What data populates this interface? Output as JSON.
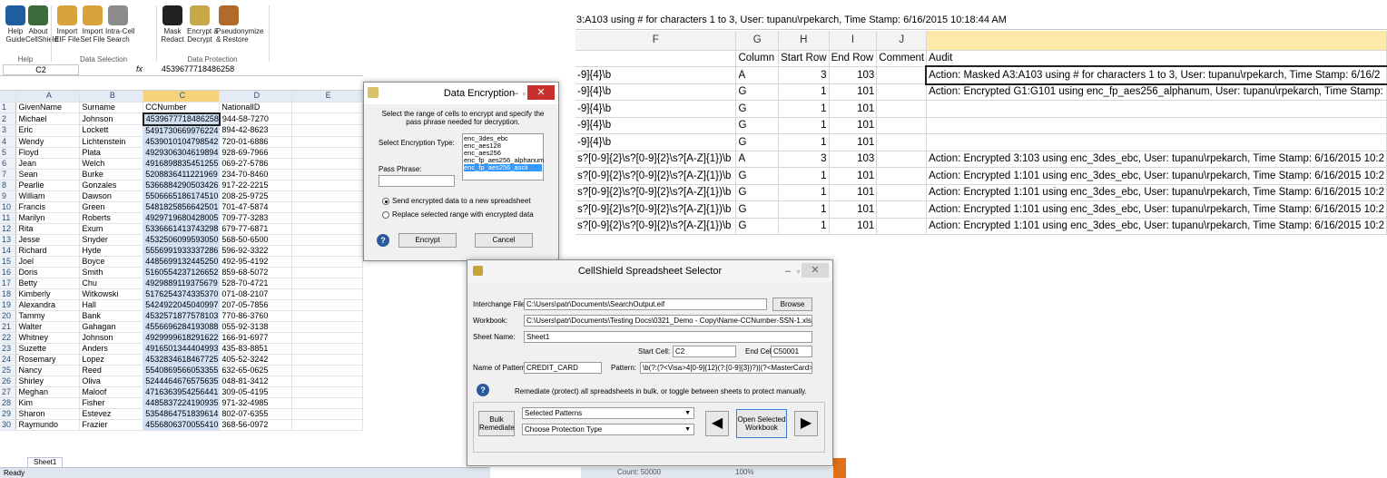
{
  "left_excel": {
    "ribbon": {
      "buttons": [
        {
          "label": "Help\nGuide",
          "icon": "help-icon"
        },
        {
          "label": "About\nCellShield",
          "icon": "shield-icon"
        },
        {
          "label": "Import\nEIF File",
          "icon": "folder-import-icon"
        },
        {
          "label": "Import\nSet File",
          "icon": "folder-import-icon"
        },
        {
          "label": "Intra-Cell\nSearch",
          "icon": "document-search-icon"
        },
        {
          "label": "Mask\nRedact",
          "icon": "mask-icon"
        },
        {
          "label": "Encrypt &\nDecrypt",
          "icon": "encrypt-icon"
        },
        {
          "label": "Pseudonymize\n& Restore",
          "icon": "people-icon"
        }
      ],
      "groups": [
        "Help",
        "Data Selection",
        "Data Protection"
      ]
    },
    "name_box": "C2",
    "fx": "fx",
    "formula_value": "4539677718486258",
    "columns": [
      "A",
      "B",
      "C",
      "D",
      "E"
    ],
    "rows": [
      [
        "GivenName",
        "Surname",
        "CCNumber",
        "NationalID"
      ],
      [
        "Michael",
        "Johnson",
        "4539677718486258",
        "944-58-7270"
      ],
      [
        "Eric",
        "Lockett",
        "5491730669976224",
        "894-42-8623"
      ],
      [
        "Wendy",
        "Lichtenstein",
        "4539010104798542",
        "720-01-6886"
      ],
      [
        "Floyd",
        "Plata",
        "4929306304619894",
        "928-69-7966"
      ],
      [
        "Jean",
        "Welch",
        "4916898835451255",
        "069-27-5786"
      ],
      [
        "Sean",
        "Burke",
        "5208836411221969",
        "234-70-8460"
      ],
      [
        "Pearlie",
        "Gonzales",
        "5366884290503426",
        "917-22-2215"
      ],
      [
        "William",
        "Dawson",
        "5506665186174510",
        "208-25-9725"
      ],
      [
        "Francis",
        "Green",
        "5481825856642501",
        "701-47-5874"
      ],
      [
        "Marilyn",
        "Roberts",
        "4929719680428005",
        "709-77-3283"
      ],
      [
        "Rita",
        "Exum",
        "5336661413743298",
        "679-77-6871"
      ],
      [
        "Jesse",
        "Snyder",
        "4532506099593050",
        "568-50-6500"
      ],
      [
        "Richard",
        "Hyde",
        "5556991933337286",
        "596-92-3322"
      ],
      [
        "Joel",
        "Boyce",
        "4485699132445250",
        "492-95-4192"
      ],
      [
        "Doris",
        "Smith",
        "5160554237126652",
        "859-68-5072"
      ],
      [
        "Betty",
        "Chu",
        "4929889119375679",
        "528-70-4721"
      ],
      [
        "Kimberly",
        "Witkowski",
        "5176254374335370",
        "071-08-2107"
      ],
      [
        "Alexandra",
        "Hall",
        "5424922045040997",
        "207-05-7856"
      ],
      [
        "Tammy",
        "Bank",
        "4532571877578103",
        "770-86-3760"
      ],
      [
        "Walter",
        "Gahagan",
        "4556696284193088",
        "055-92-3138"
      ],
      [
        "Whitney",
        "Johnson",
        "4929999618291622",
        "166-91-6977"
      ],
      [
        "Suzette",
        "Anders",
        "4916501344404993",
        "435-83-8851"
      ],
      [
        "Rosemary",
        "Lopez",
        "4532834618467725",
        "405-52-3242"
      ],
      [
        "Nancy",
        "Reed",
        "5540869566053355",
        "632-65-0625"
      ],
      [
        "Shirley",
        "Oliva",
        "5244464676575635",
        "048-81-3412"
      ],
      [
        "Meghan",
        "Maloof",
        "4716363954256441",
        "309-05-4195"
      ],
      [
        "Kim",
        "Fisher",
        "4485837224190935",
        "971-32-4985"
      ],
      [
        "Sharon",
        "Estevez",
        "5354864751839614",
        "802-07-6355"
      ],
      [
        "Raymundo",
        "Frazier",
        "4556806370055410",
        "368-56-0972"
      ]
    ],
    "sheet_tab": "Sheet1",
    "status": "Ready",
    "status_right": "Count: 50000",
    "zoom": "100%"
  },
  "right_excel": {
    "formula_text": "3:A103 using # for characters 1 to 3, User: tupanu\\rpekarch, Time Stamp: 6/16/2015 10:18:44 AM",
    "columns": [
      "F",
      "G",
      "H",
      "I",
      "J",
      ""
    ],
    "header": [
      "",
      "Column",
      "Start Row",
      "End Row",
      "Comment",
      "Audit"
    ],
    "rows": [
      [
        "-9]{4}\\b",
        "A",
        "3",
        "103",
        "",
        "Action: Masked A3:A103 using # for characters 1 to 3, User: tupanu\\rpekarch, Time Stamp: 6/16/2"
      ],
      [
        "-9]{4}\\b",
        "G",
        "1",
        "101",
        "",
        "Action: Encrypted G1:G101 using enc_fp_aes256_alphanum, User: tupanu\\rpekarch, Time Stamp:"
      ],
      [
        "-9]{4}\\b",
        "G",
        "1",
        "101",
        "",
        ""
      ],
      [
        "-9]{4}\\b",
        "G",
        "1",
        "101",
        "",
        ""
      ],
      [
        "-9]{4}\\b",
        "G",
        "1",
        "101",
        "",
        ""
      ],
      [
        "s?[0-9]{2}\\s?[0-9]{2}\\s?[A-Z]{1})\\b",
        "A",
        "3",
        "103",
        "",
        "Action: Encrypted 3:103 using enc_3des_ebc, User: tupanu\\rpekarch, Time Stamp: 6/16/2015 10:2"
      ],
      [
        "s?[0-9]{2}\\s?[0-9]{2}\\s?[A-Z]{1})\\b",
        "G",
        "1",
        "101",
        "",
        "Action: Encrypted 1:101 using enc_3des_ebc, User: tupanu\\rpekarch, Time Stamp: 6/16/2015 10:2"
      ],
      [
        "s?[0-9]{2}\\s?[0-9]{2}\\s?[A-Z]{1})\\b",
        "G",
        "1",
        "101",
        "",
        "Action: Encrypted 1:101 using enc_3des_ebc, User: tupanu\\rpekarch, Time Stamp: 6/16/2015 10:2"
      ],
      [
        "s?[0-9]{2}\\s?[0-9]{2}\\s?[A-Z]{1})\\b",
        "G",
        "1",
        "101",
        "",
        "Action: Encrypted 1:101 using enc_3des_ebc, User: tupanu\\rpekarch, Time Stamp: 6/16/2015 10:2"
      ],
      [
        "s?[0-9]{2}\\s?[0-9]{2}\\s?[A-Z]{1})\\b",
        "G",
        "1",
        "101",
        "",
        "Action: Encrypted 1:101 using enc_3des_ebc, User: tupanu\\rpekarch, Time Stamp: 6/16/2015 10:2"
      ]
    ]
  },
  "encryption_dialog": {
    "title": "Data Encryption",
    "instructions": "Select the range of cells to encrypt and specify the pass phrase needed for decryption.",
    "type_label": "Select Encryption Type:",
    "types": [
      "enc_3des_ebc",
      "enc_aes128",
      "enc_aes256",
      "enc_fp_aes256_alphanum",
      "enc_fp_aes256_ascii"
    ],
    "selected_type_index": 4,
    "pass_label": "Pass Phrase:",
    "pass_value": "",
    "option_new": "Send encrypted data to a new spreadsheet",
    "option_replace": "Replace selected range with encrypted data",
    "encrypt_button": "Encrypt",
    "cancel_button": "Cancel"
  },
  "selector_dialog": {
    "title": "CellShield Spreadsheet Selector",
    "interchange_label": "Interchange File:",
    "interchange_value": "C:\\Users\\patr\\Documents\\SearchOutput.eif",
    "browse_button": "Browse",
    "workbook_label": "Workbook:",
    "workbook_value": "C:\\Users\\patr\\Documents\\Testing Docs\\0321_Demo - Copy\\Name-CCNumber-SSN-1.xlsx",
    "sheet_label": "Sheet Name:",
    "sheet_value": "Sheet1",
    "start_label": "Start Cell:",
    "start_value": "C2",
    "end_label": "End Cell:",
    "end_value": "C50001",
    "pattern_name_label": "Name of Pattern:",
    "pattern_name_value": "CREDIT_CARD",
    "pattern_label": "Pattern:",
    "pattern_value": "\\b(?:(?<Visa>4[0-9]{12}(?:[0-9]{3})?)|(?<MasterCard>5[1-5",
    "info_text": "Remediate (protect) all spreadsheets in bulk, or toggle between sheets to protect manually.",
    "bulk_button": "Bulk\nRemediate",
    "selected_patterns": "Selected Patterns",
    "protection_type": "Choose Protection Type",
    "open_button": "Open Selected\nWorkbook"
  }
}
